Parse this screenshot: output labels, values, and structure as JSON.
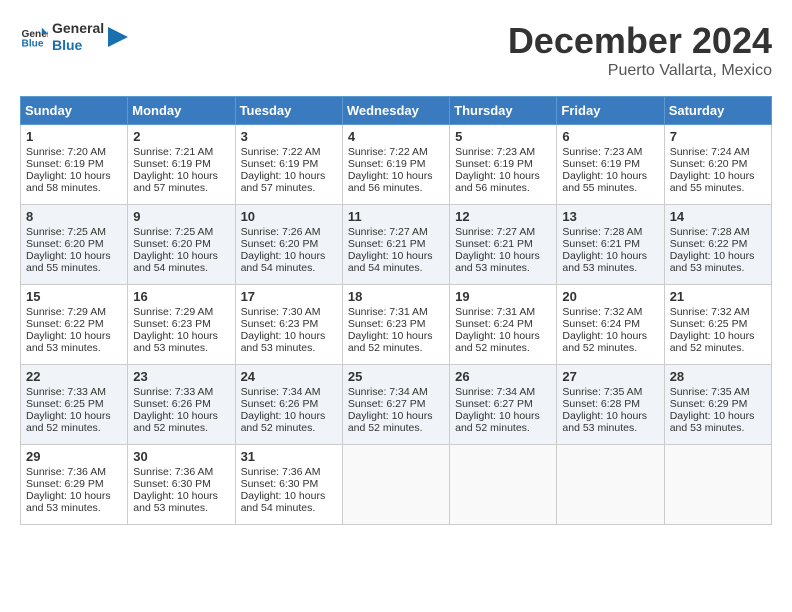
{
  "header": {
    "logo_general": "General",
    "logo_blue": "Blue",
    "month": "December 2024",
    "location": "Puerto Vallarta, Mexico"
  },
  "days_of_week": [
    "Sunday",
    "Monday",
    "Tuesday",
    "Wednesday",
    "Thursday",
    "Friday",
    "Saturday"
  ],
  "weeks": [
    [
      {
        "day": 1,
        "rise": "7:20 AM",
        "set": "6:19 PM",
        "light": "10 hours and 58 minutes."
      },
      {
        "day": 2,
        "rise": "7:21 AM",
        "set": "6:19 PM",
        "light": "10 hours and 57 minutes."
      },
      {
        "day": 3,
        "rise": "7:22 AM",
        "set": "6:19 PM",
        "light": "10 hours and 57 minutes."
      },
      {
        "day": 4,
        "rise": "7:22 AM",
        "set": "6:19 PM",
        "light": "10 hours and 56 minutes."
      },
      {
        "day": 5,
        "rise": "7:23 AM",
        "set": "6:19 PM",
        "light": "10 hours and 56 minutes."
      },
      {
        "day": 6,
        "rise": "7:23 AM",
        "set": "6:19 PM",
        "light": "10 hours and 55 minutes."
      },
      {
        "day": 7,
        "rise": "7:24 AM",
        "set": "6:20 PM",
        "light": "10 hours and 55 minutes."
      }
    ],
    [
      {
        "day": 8,
        "rise": "7:25 AM",
        "set": "6:20 PM",
        "light": "10 hours and 55 minutes."
      },
      {
        "day": 9,
        "rise": "7:25 AM",
        "set": "6:20 PM",
        "light": "10 hours and 54 minutes."
      },
      {
        "day": 10,
        "rise": "7:26 AM",
        "set": "6:20 PM",
        "light": "10 hours and 54 minutes."
      },
      {
        "day": 11,
        "rise": "7:27 AM",
        "set": "6:21 PM",
        "light": "10 hours and 54 minutes."
      },
      {
        "day": 12,
        "rise": "7:27 AM",
        "set": "6:21 PM",
        "light": "10 hours and 53 minutes."
      },
      {
        "day": 13,
        "rise": "7:28 AM",
        "set": "6:21 PM",
        "light": "10 hours and 53 minutes."
      },
      {
        "day": 14,
        "rise": "7:28 AM",
        "set": "6:22 PM",
        "light": "10 hours and 53 minutes."
      }
    ],
    [
      {
        "day": 15,
        "rise": "7:29 AM",
        "set": "6:22 PM",
        "light": "10 hours and 53 minutes."
      },
      {
        "day": 16,
        "rise": "7:29 AM",
        "set": "6:23 PM",
        "light": "10 hours and 53 minutes."
      },
      {
        "day": 17,
        "rise": "7:30 AM",
        "set": "6:23 PM",
        "light": "10 hours and 53 minutes."
      },
      {
        "day": 18,
        "rise": "7:31 AM",
        "set": "6:23 PM",
        "light": "10 hours and 52 minutes."
      },
      {
        "day": 19,
        "rise": "7:31 AM",
        "set": "6:24 PM",
        "light": "10 hours and 52 minutes."
      },
      {
        "day": 20,
        "rise": "7:32 AM",
        "set": "6:24 PM",
        "light": "10 hours and 52 minutes."
      },
      {
        "day": 21,
        "rise": "7:32 AM",
        "set": "6:25 PM",
        "light": "10 hours and 52 minutes."
      }
    ],
    [
      {
        "day": 22,
        "rise": "7:33 AM",
        "set": "6:25 PM",
        "light": "10 hours and 52 minutes."
      },
      {
        "day": 23,
        "rise": "7:33 AM",
        "set": "6:26 PM",
        "light": "10 hours and 52 minutes."
      },
      {
        "day": 24,
        "rise": "7:34 AM",
        "set": "6:26 PM",
        "light": "10 hours and 52 minutes."
      },
      {
        "day": 25,
        "rise": "7:34 AM",
        "set": "6:27 PM",
        "light": "10 hours and 52 minutes."
      },
      {
        "day": 26,
        "rise": "7:34 AM",
        "set": "6:27 PM",
        "light": "10 hours and 52 minutes."
      },
      {
        "day": 27,
        "rise": "7:35 AM",
        "set": "6:28 PM",
        "light": "10 hours and 53 minutes."
      },
      {
        "day": 28,
        "rise": "7:35 AM",
        "set": "6:29 PM",
        "light": "10 hours and 53 minutes."
      }
    ],
    [
      {
        "day": 29,
        "rise": "7:36 AM",
        "set": "6:29 PM",
        "light": "10 hours and 53 minutes."
      },
      {
        "day": 30,
        "rise": "7:36 AM",
        "set": "6:30 PM",
        "light": "10 hours and 53 minutes."
      },
      {
        "day": 31,
        "rise": "7:36 AM",
        "set": "6:30 PM",
        "light": "10 hours and 54 minutes."
      },
      null,
      null,
      null,
      null
    ]
  ]
}
